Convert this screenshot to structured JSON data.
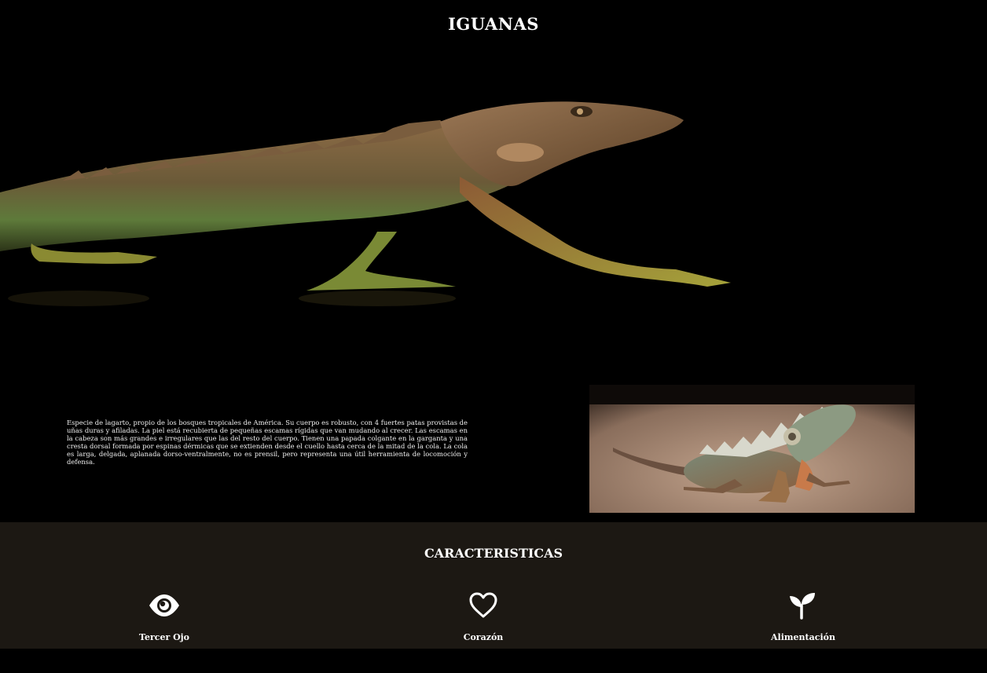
{
  "header": {
    "title": "IGUANAS"
  },
  "intro": {
    "paragraph": "Especie de lagarto, propio de los bosques tropicales de América. Su cuerpo es robusto, con 4 fuertes patas provistas de uñas duras y afiladas. La piel está recubierta de pequeñas escamas rígidas que van mudando al crecer. Las escamas en la cabeza son más grandes e irregulares que las del resto del cuerpo. Tienen una papada colgante en la garganta y una cresta dorsal formada por espinas dérmicas que se extienden desde el cuello hasta cerca de la mitad de la cola. La cola es larga, delgada, aplanada dorso-ventralmente, no es prensil, pero representa una útil herramienta de locomoción y defensa."
  },
  "features": {
    "title": "CARACTERISTICAS",
    "items": [
      {
        "label": "Tercer Ojo",
        "icon": "eye-icon"
      },
      {
        "label": "Corazón",
        "icon": "heart-icon"
      },
      {
        "label": "Alimentación",
        "icon": "seedling-icon"
      }
    ]
  },
  "colors": {
    "background": "#000000",
    "features_background": "#1c1813",
    "text": "#ffffff"
  }
}
